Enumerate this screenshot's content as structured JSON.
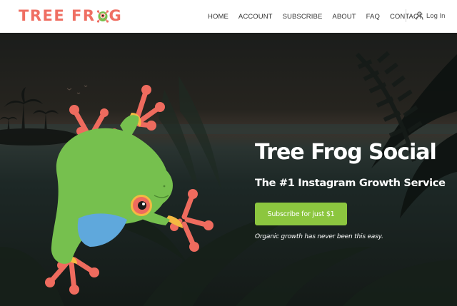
{
  "brand": {
    "logo_word_start": "TREE FR",
    "logo_word_end": "G",
    "logo_icon": "frog-icon",
    "color": "#ef6f63"
  },
  "nav": {
    "items": [
      {
        "label": "HOME"
      },
      {
        "label": "ACCOUNT"
      },
      {
        "label": "SUBSCRIBE"
      },
      {
        "label": "ABOUT"
      },
      {
        "label": "FAQ"
      },
      {
        "label": "CONTACT"
      }
    ],
    "login_label": "Log In",
    "login_icon": "user-icon"
  },
  "hero": {
    "title": "Tree Frog Social",
    "subtitle": "The #1 Instagram Growth Service",
    "cta_label": "Subscribe for just $1",
    "tagline": "Organic growth has never been this easy.",
    "illustration": "tree-frog-icon",
    "colors": {
      "accent_green": "#8cc63f",
      "frog_green": "#76c04e",
      "frog_orange": "#ee6b5e",
      "frog_blue": "#5fa8dc",
      "background": "#1c1f1c"
    }
  }
}
